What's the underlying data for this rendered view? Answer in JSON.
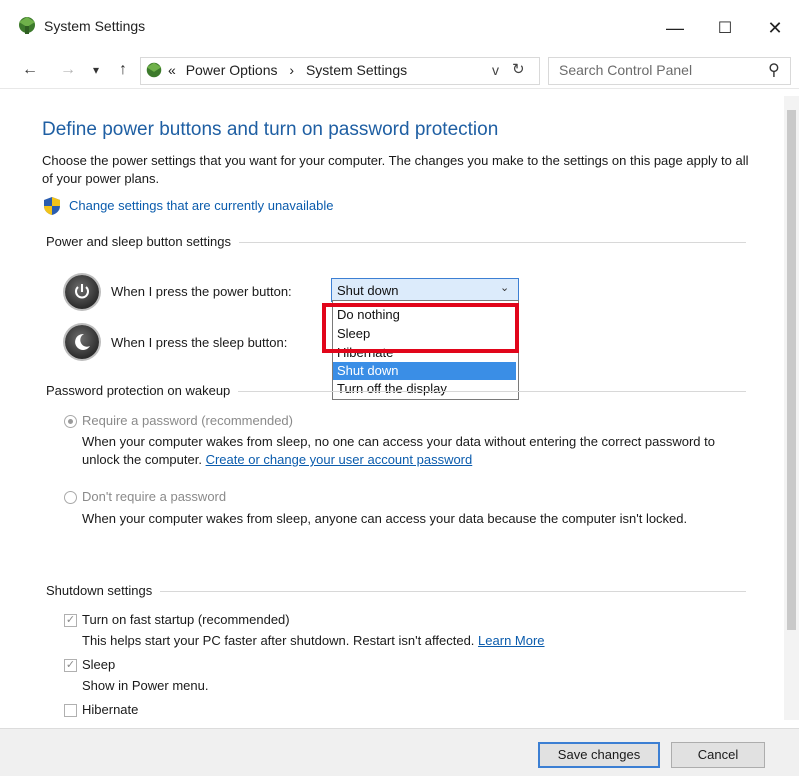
{
  "window": {
    "title": "System Settings",
    "minimize": "—",
    "maximize": "☐",
    "close": "✕"
  },
  "nav": {
    "back": "←",
    "forward": "→",
    "recent": "▾",
    "up": "↑",
    "breadcrumb_sep": "«",
    "crumb_1": "Power Options",
    "crumb_arrow": "›",
    "crumb_2": "System Settings",
    "dropdown": "v",
    "refresh": "↻",
    "search_placeholder": "Search Control Panel",
    "search_icon": "⚲"
  },
  "content": {
    "heading": "Define power buttons and turn on password protection",
    "intro": "Choose the power settings that you want for your computer. The changes you make to the settings on this page apply to all of your power plans.",
    "change_link": "Change settings that are currently unavailable",
    "power_section": "Power and sleep button settings",
    "power_button_label": "When I press the power button:",
    "sleep_button_label": "When I press the sleep button:",
    "dropdown": {
      "selected": "Shut down",
      "arrow": "⌄",
      "options": [
        "Do nothing",
        "Sleep",
        "Hibernate",
        "Shut down",
        "Turn off the display"
      ],
      "highlighted": "Shut down"
    },
    "password_section": "Password protection on wakeup",
    "require_pw_label": "Require a password (recommended)",
    "require_pw_desc": "When your computer wakes from sleep, no one can access your data without entering the correct password to unlock the computer.",
    "require_pw_link": "Create or change your user account password",
    "no_pw_label": "Don't require a password",
    "no_pw_desc": "When your computer wakes from sleep, anyone can access your data because the computer isn't locked.",
    "shutdown_section": "Shutdown settings",
    "fast_startup_label": "Turn on fast startup (recommended)",
    "fast_startup_desc": "This helps start your PC faster after shutdown. Restart isn't affected.",
    "learn_more": "Learn More",
    "sleep_label": "Sleep",
    "sleep_desc": "Show in Power menu.",
    "hibernate_label": "Hibernate",
    "check_mark": "✓"
  },
  "footer": {
    "save": "Save changes",
    "cancel": "Cancel"
  },
  "colors": {
    "heading": "#1f5fa3",
    "link": "#0b5cad",
    "highlight": "#3a8ee6",
    "callout": "#e1051a"
  }
}
